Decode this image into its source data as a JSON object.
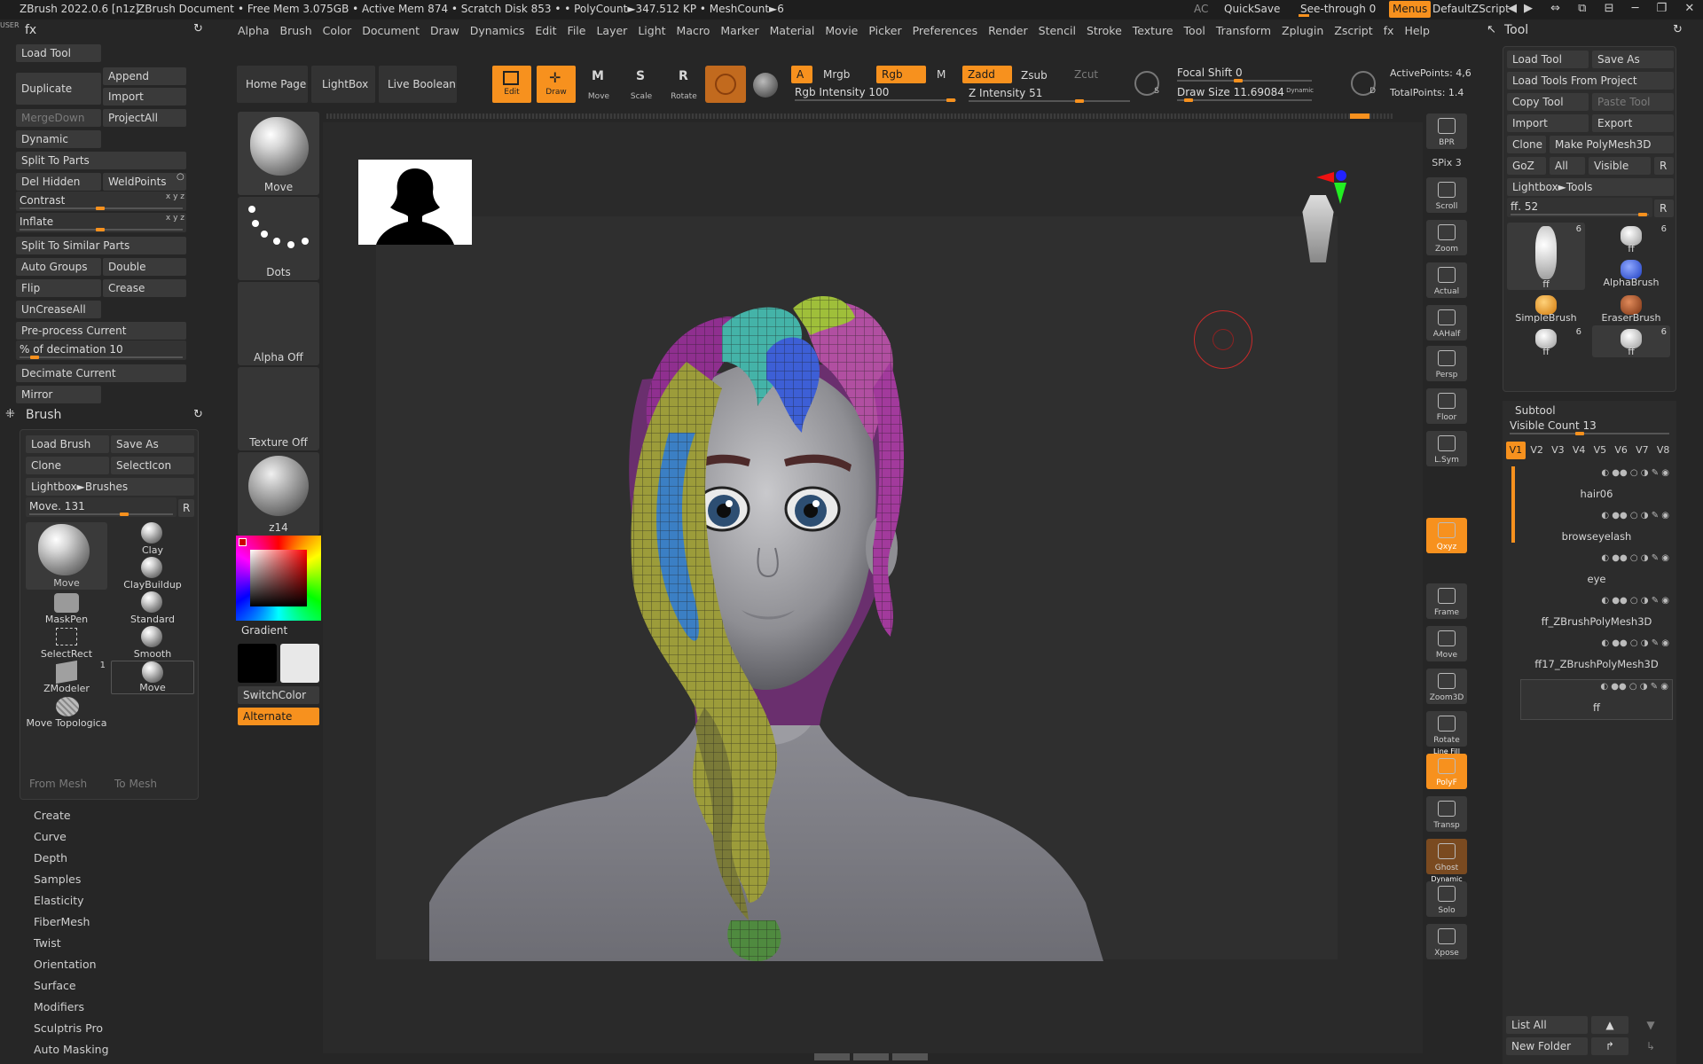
{
  "titlebar": {
    "app": "ZBrush 2022.0.6 [n1z]",
    "doc": "ZBrush Document",
    "stats": "• Free Mem 3.075GB • Active Mem 874 • Scratch Disk 853 • • PolyCount►347.512 KP • MeshCount►6",
    "ac": "AC",
    "quicksave": "QuickSave",
    "seethrough": "See-through 0",
    "menus": "Menus",
    "script": "DefaultZScript"
  },
  "menubar": [
    "Alpha",
    "Brush",
    "Color",
    "Document",
    "Draw",
    "Dynamics",
    "Edit",
    "File",
    "Layer",
    "Light",
    "Macro",
    "Marker",
    "Material",
    "Movie",
    "Picker",
    "Preferences",
    "Render",
    "Stencil",
    "Stroke",
    "Texture",
    "Tool",
    "Transform",
    "Zplugin",
    "Zscript",
    "fx",
    "Help"
  ],
  "fxpanel": {
    "title": "fx",
    "load_tool": "Load Tool",
    "duplicate": "Duplicate",
    "append": "Append",
    "import": "Import",
    "mergedown": "MergeDown",
    "projectall": "ProjectAll",
    "dynamic": "Dynamic",
    "split_to_parts": "Split To Parts",
    "del_hidden": "Del Hidden",
    "weldpoints": "WeldPoints",
    "contrast": "Contrast",
    "inflate": "Inflate",
    "split_similar": "Split To Similar Parts",
    "auto_groups": "Auto Groups",
    "double": "Double",
    "flip": "Flip",
    "crease": "Crease",
    "uncreaseall": "UnCreaseAll",
    "preprocess": "Pre-process Current",
    "decimation": "% of decimation 10",
    "decimate_current": "Decimate Current",
    "mirror": "Mirror",
    "xyz": "x y z"
  },
  "brushpanel": {
    "title": "Brush",
    "load_brush": "Load Brush",
    "save_as": "Save As",
    "clone": "Clone",
    "selecticon": "SelectIcon",
    "lightbox": "Lightbox►Brushes",
    "move_slider": "Move. 131",
    "r": "R",
    "brushes": [
      "Move",
      "Clay",
      "ClayBuildup",
      "MaskPen",
      "Standard",
      "SelectRect",
      "Smooth",
      "ZModeler",
      "Move",
      "Move Topologica"
    ],
    "zmodeler_count": "1",
    "from_mesh": "From Mesh",
    "to_mesh": "To Mesh"
  },
  "submenus": [
    "Create",
    "Curve",
    "Depth",
    "Samples",
    "Elasticity",
    "FiberMesh",
    "Twist",
    "Orientation",
    "Surface",
    "Modifiers",
    "Sculptris Pro",
    "Auto Masking"
  ],
  "shelf": {
    "home": "Home Page",
    "lightbox": "LightBox",
    "liveboolean": "Live Boolean",
    "edit": "Edit",
    "draw": "Draw",
    "move": "Move",
    "scale": "Scale",
    "rotate": "Rotate",
    "a": "A",
    "mrgb": "Mrgb",
    "rgb": "Rgb",
    "m": "M",
    "zadd": "Zadd",
    "zsub": "Zsub",
    "zcut": "Zcut",
    "rgb_intensity": "Rgb Intensity 100",
    "z_intensity": "Z Intensity 51",
    "focal_shift": "Focal Shift 0",
    "draw_size": "Draw Size 11.69084",
    "dynamic": "Dynamic",
    "s": "S",
    "d": "D",
    "active_points": "ActivePoints: 4,6",
    "total_points": "TotalPoints: 1.4"
  },
  "leftshelf": {
    "move": "Move",
    "dots": "Dots",
    "alpha_off": "Alpha Off",
    "texture_off": "Texture Off",
    "material": "z14",
    "gradient": "Gradient",
    "switchcolor": "SwitchColor",
    "alternate": "Alternate"
  },
  "righttools": [
    {
      "id": "bpr",
      "label": "BPR"
    },
    {
      "id": "spix",
      "label": "SPix 3"
    },
    {
      "id": "scroll",
      "label": "Scroll"
    },
    {
      "id": "zoom",
      "label": "Zoom"
    },
    {
      "id": "actual",
      "label": "Actual"
    },
    {
      "id": "aahalf",
      "label": "AAHalf"
    },
    {
      "id": "persp",
      "label": "Persp"
    },
    {
      "id": "floor",
      "label": "Floor"
    },
    {
      "id": "lsym",
      "label": "L.Sym"
    },
    {
      "id": "xyz",
      "label": "Qxyz"
    },
    {
      "id": "frame",
      "label": "Frame"
    },
    {
      "id": "move",
      "label": "Move"
    },
    {
      "id": "zoom3d",
      "label": "Zoom3D"
    },
    {
      "id": "rotate",
      "label": "Rotate"
    },
    {
      "id": "polyf",
      "label": "PolyF"
    },
    {
      "id": "linefill",
      "label": "Line Fill"
    },
    {
      "id": "transp",
      "label": "Transp"
    },
    {
      "id": "ghost",
      "label": "Ghost"
    },
    {
      "id": "solo",
      "label": "Solo"
    },
    {
      "id": "dynamic2",
      "label": "Dynamic"
    },
    {
      "id": "xpose",
      "label": "Xpose"
    }
  ],
  "toolpanel": {
    "title": "Tool",
    "load_tool": "Load Tool",
    "save_as": "Save As",
    "load_from_project": "Load Tools From Project",
    "copy_tool": "Copy Tool",
    "paste_tool": "Paste Tool",
    "import": "Import",
    "export": "Export",
    "clone": "Clone",
    "make_polymesh": "Make PolyMesh3D",
    "goz": "GoZ",
    "all": "All",
    "visible": "Visible",
    "r": "R",
    "lightbox_tools": "Lightbox►Tools",
    "ff_slider": "ff. 52",
    "thumbs": [
      {
        "name": "ff",
        "count": "6"
      },
      {
        "name": "ff",
        "count": "6"
      },
      {
        "name": "AlphaBrush",
        "count": ""
      },
      {
        "name": "SimpleBrush",
        "count": ""
      },
      {
        "name": "EraserBrush",
        "count": ""
      },
      {
        "name": "ff",
        "count": "6"
      },
      {
        "name": "ff",
        "count": "6"
      }
    ]
  },
  "subtool": {
    "title": "Subtool",
    "visible_count": "Visible Count 13",
    "versions": [
      "V1",
      "V2",
      "V3",
      "V4",
      "V5",
      "V6",
      "V7",
      "V8"
    ],
    "items": [
      "hair06",
      "browseyelash",
      "eye",
      "ff_ZBrushPolyMesh3D",
      "ff17_ZBrushPolyMesh3D",
      "ff"
    ],
    "list_all": "List All",
    "new_folder": "New Folder"
  },
  "colors": {
    "accent": "#f7911e",
    "panel": "#2c2c2c",
    "background": "#262626",
    "canvas": "#303030"
  }
}
